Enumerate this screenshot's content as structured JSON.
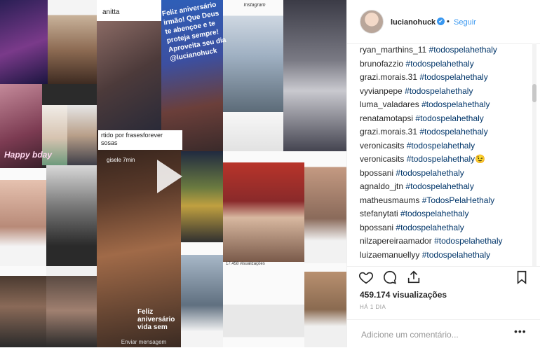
{
  "media": {
    "collage": {
      "anitta_label": "anitta",
      "greeting": "Feliz aniversário irmão! Que Deus te abençoe e te proteja sempre! Aproveita seu dia @lucianohuck",
      "frases_label": "rtido por frasesforever sosas",
      "happy_label": "Happy bday",
      "gisele_label": "gisele 7min",
      "feliz_label": "Feliz aniversário vida sem",
      "enviar_label": "Enviar mensagem",
      "instagram_label": "Instagram",
      "views_tiny": "17.458 visualizações"
    }
  },
  "header": {
    "username": "lucianohuck",
    "verified_glyph": "✔",
    "separator": "•",
    "follow_label": "Seguir"
  },
  "comments": [
    {
      "user": "ryan_marthins_11",
      "tag": "#todospelahethaly"
    },
    {
      "user": "brunofazzio",
      "tag": "#todospelahethaly"
    },
    {
      "user": "grazi.morais.31",
      "tag": "#todospelahethaly"
    },
    {
      "user": "vyvianpepe",
      "tag": "#todospelahethaly"
    },
    {
      "user": "luma_valadares",
      "tag": "#todospelahethaly"
    },
    {
      "user": "renatamotapsi",
      "tag": "#todospelahethaly"
    },
    {
      "user": "grazi.morais.31",
      "tag": "#todospelahethaly"
    },
    {
      "user": "veronicasits",
      "tag": "#todospelahethaly"
    },
    {
      "user": "veronicasits",
      "tag": "#todospelahethaly😉"
    },
    {
      "user": "bpossani",
      "tag": "#todospelahethaly"
    },
    {
      "user": "agnaldo_jtn",
      "tag": "#todospelahethaly"
    },
    {
      "user": "matheusmaums",
      "tag": "#TodosPelaHethaly"
    },
    {
      "user": "stefanytati",
      "tag": "#todospelahethaly"
    },
    {
      "user": "bpossani",
      "tag": "#todospelahethaly"
    },
    {
      "user": "nilzapereiraamador",
      "tag": "#todospelahethaly"
    },
    {
      "user": "luizaemanuellyy",
      "tag": "#todospelahethaly"
    }
  ],
  "actions": {
    "like_icon": "heart-icon",
    "comment_icon": "comment-icon",
    "share_icon": "share-icon",
    "save_icon": "bookmark-icon"
  },
  "stats": {
    "views": "459.174 visualizações",
    "date": "HÁ 1 DIA"
  },
  "add_comment": {
    "placeholder": "Adicione um comentário...",
    "more_label": "•••"
  },
  "colors": {
    "link_blue": "#3897f0",
    "hashtag_blue": "#003569",
    "text_dark": "#262626",
    "muted": "#999999"
  }
}
